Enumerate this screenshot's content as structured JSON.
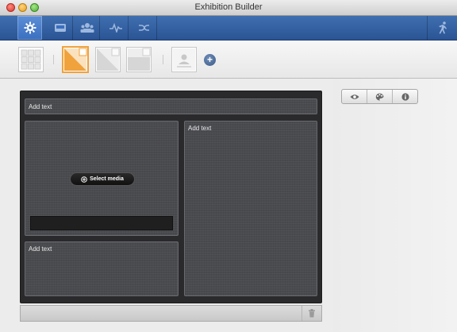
{
  "window": {
    "title": "Exhibition Builder"
  },
  "nav": {
    "items": [
      {
        "name": "settings",
        "icon": "gear-icon",
        "active": true
      },
      {
        "name": "storage",
        "icon": "tray-icon"
      },
      {
        "name": "users",
        "icon": "people-icon"
      },
      {
        "name": "activity",
        "icon": "pulse-icon"
      },
      {
        "name": "shuffle",
        "icon": "shuffle-icon"
      }
    ],
    "right_icon": "run-icon"
  },
  "toolbar": {
    "layouts": [
      {
        "name": "grid-layout",
        "selected": false
      },
      {
        "name": "layout-1",
        "selected": true
      },
      {
        "name": "layout-2",
        "selected": false
      },
      {
        "name": "layout-3",
        "selected": false
      },
      {
        "name": "single-image-layout",
        "selected": false
      }
    ],
    "add_label": "+"
  },
  "canvas": {
    "header_text": "Add text",
    "right_text": "Add text",
    "bottom_left_text": "Add text",
    "select_media_label": "Select media"
  },
  "inspector": {
    "tabs": [
      "eye-icon",
      "palette-icon",
      "info-icon"
    ]
  },
  "colors": {
    "accent": "#f0a23c",
    "nav_bg": "#2b5494"
  }
}
